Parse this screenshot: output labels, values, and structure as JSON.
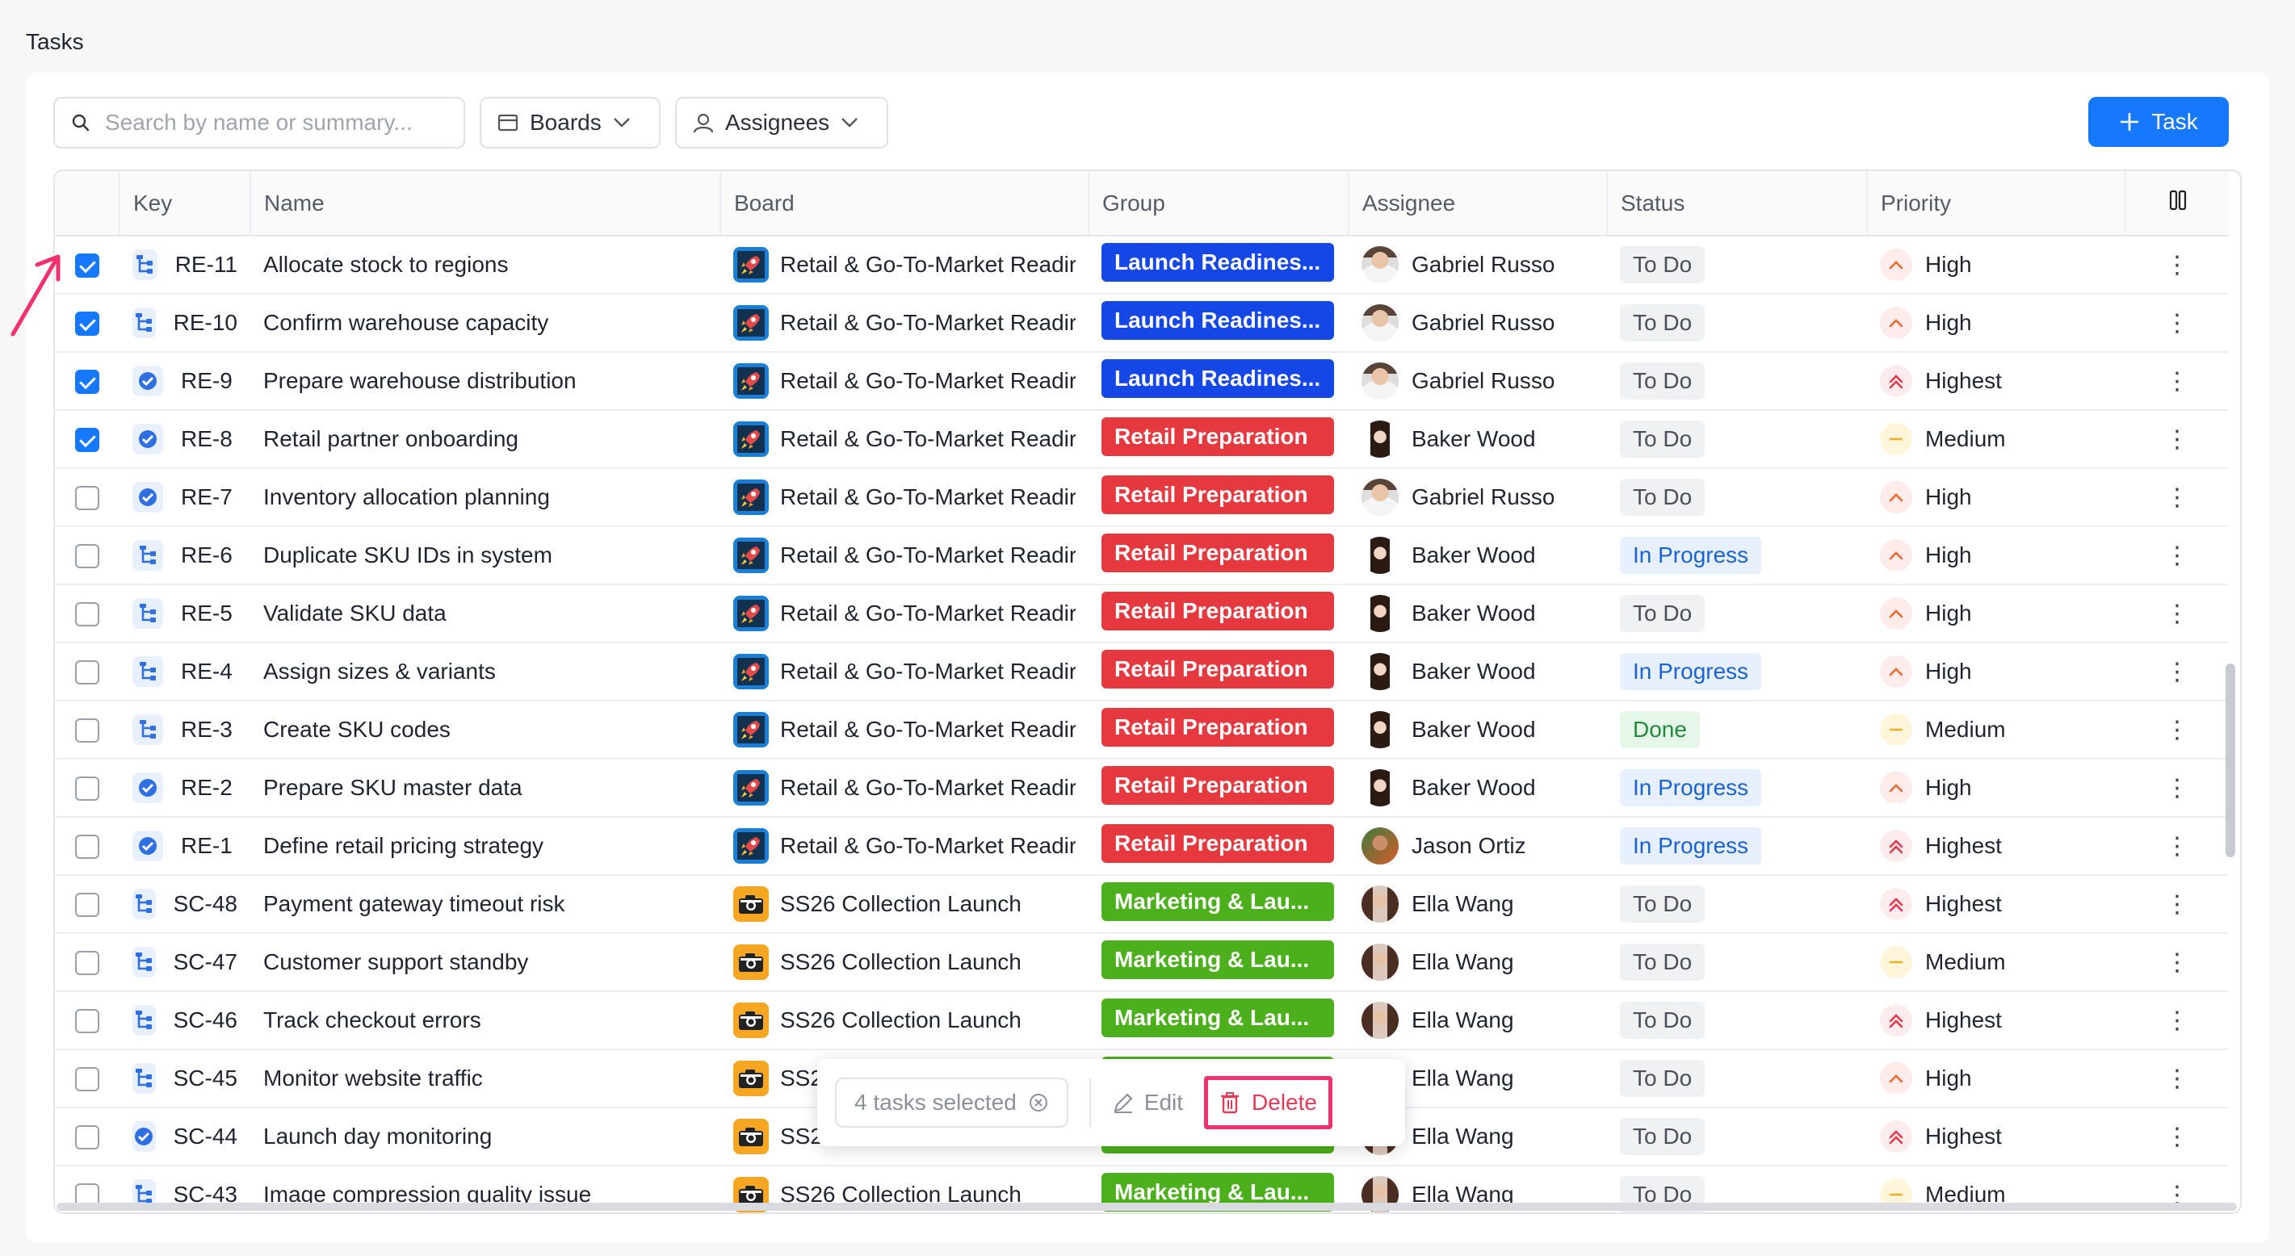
{
  "page": {
    "title": "Tasks"
  },
  "toolbar": {
    "search_placeholder": "Search by name or summary...",
    "boards_label": "Boards",
    "assignees_label": "Assignees",
    "add_task_label": "Task"
  },
  "table": {
    "columns": [
      "Key",
      "Name",
      "Board",
      "Group",
      "Assignee",
      "Status",
      "Priority"
    ],
    "rows": [
      {
        "checked": true,
        "type": "subtask",
        "key": "RE-11",
        "name": "Allocate stock to regions",
        "board": "Retail & Go-To-Market Readir",
        "board_icon": "rocket",
        "group": "Launch Readines...",
        "group_color": "#1447e6",
        "assignee": "Gabriel Russo",
        "avatar": "male",
        "status": "To Do",
        "priority": "High"
      },
      {
        "checked": true,
        "type": "subtask",
        "key": "RE-10",
        "name": "Confirm warehouse capacity",
        "board": "Retail & Go-To-Market Readir",
        "board_icon": "rocket",
        "group": "Launch Readines...",
        "group_color": "#1447e6",
        "assignee": "Gabriel Russo",
        "avatar": "male",
        "status": "To Do",
        "priority": "High"
      },
      {
        "checked": true,
        "type": "task",
        "key": "RE-9",
        "name": "Prepare warehouse distribution",
        "board": "Retail & Go-To-Market Readir",
        "board_icon": "rocket",
        "group": "Launch Readines...",
        "group_color": "#1447e6",
        "assignee": "Gabriel Russo",
        "avatar": "male",
        "status": "To Do",
        "priority": "Highest"
      },
      {
        "checked": true,
        "type": "task",
        "key": "RE-8",
        "name": "Retail partner onboarding",
        "board": "Retail & Go-To-Market Readir",
        "board_icon": "rocket",
        "group": "Retail Preparation",
        "group_color": "#e5393f",
        "assignee": "Baker Wood",
        "avatar": "female",
        "status": "To Do",
        "priority": "Medium"
      },
      {
        "checked": false,
        "type": "task",
        "key": "RE-7",
        "name": "Inventory allocation planning",
        "board": "Retail & Go-To-Market Readir",
        "board_icon": "rocket",
        "group": "Retail Preparation",
        "group_color": "#e5393f",
        "assignee": "Gabriel Russo",
        "avatar": "male",
        "status": "To Do",
        "priority": "High"
      },
      {
        "checked": false,
        "type": "subtask",
        "key": "RE-6",
        "name": "Duplicate SKU IDs in system",
        "board": "Retail & Go-To-Market Readir",
        "board_icon": "rocket",
        "group": "Retail Preparation",
        "group_color": "#e5393f",
        "assignee": "Baker Wood",
        "avatar": "female",
        "status": "In Progress",
        "priority": "High"
      },
      {
        "checked": false,
        "type": "subtask",
        "key": "RE-5",
        "name": "Validate SKU data",
        "board": "Retail & Go-To-Market Readir",
        "board_icon": "rocket",
        "group": "Retail Preparation",
        "group_color": "#e5393f",
        "assignee": "Baker Wood",
        "avatar": "female",
        "status": "To Do",
        "priority": "High"
      },
      {
        "checked": false,
        "type": "subtask",
        "key": "RE-4",
        "name": "Assign sizes & variants",
        "board": "Retail & Go-To-Market Readir",
        "board_icon": "rocket",
        "group": "Retail Preparation",
        "group_color": "#e5393f",
        "assignee": "Baker Wood",
        "avatar": "female",
        "status": "In Progress",
        "priority": "High"
      },
      {
        "checked": false,
        "type": "subtask",
        "key": "RE-3",
        "name": "Create SKU codes",
        "board": "Retail & Go-To-Market Readir",
        "board_icon": "rocket",
        "group": "Retail Preparation",
        "group_color": "#e5393f",
        "assignee": "Baker Wood",
        "avatar": "female",
        "status": "Done",
        "priority": "Medium"
      },
      {
        "checked": false,
        "type": "task",
        "key": "RE-2",
        "name": "Prepare SKU master data",
        "board": "Retail & Go-To-Market Readir",
        "board_icon": "rocket",
        "group": "Retail Preparation",
        "group_color": "#e5393f",
        "assignee": "Baker Wood",
        "avatar": "female",
        "status": "In Progress",
        "priority": "High"
      },
      {
        "checked": false,
        "type": "task",
        "key": "RE-1",
        "name": "Define retail pricing strategy",
        "board": "Retail & Go-To-Market Readir",
        "board_icon": "rocket",
        "group": "Retail Preparation",
        "group_color": "#e5393f",
        "assignee": "Jason Ortiz",
        "avatar": "jason",
        "status": "In Progress",
        "priority": "Highest"
      },
      {
        "checked": false,
        "type": "subtask",
        "key": "SC-48",
        "name": "Payment gateway timeout risk",
        "board": "SS26 Collection Launch",
        "board_icon": "camera",
        "group": "Marketing & Lau...",
        "group_color": "#4caf1c",
        "assignee": "Ella Wang",
        "avatar": "ella",
        "status": "To Do",
        "priority": "Highest"
      },
      {
        "checked": false,
        "type": "subtask",
        "key": "SC-47",
        "name": "Customer support standby",
        "board": "SS26 Collection Launch",
        "board_icon": "camera",
        "group": "Marketing & Lau...",
        "group_color": "#4caf1c",
        "assignee": "Ella Wang",
        "avatar": "ella",
        "status": "To Do",
        "priority": "Medium"
      },
      {
        "checked": false,
        "type": "subtask",
        "key": "SC-46",
        "name": "Track checkout errors",
        "board": "SS26 Collection Launch",
        "board_icon": "camera",
        "group": "Marketing & Lau...",
        "group_color": "#4caf1c",
        "assignee": "Ella Wang",
        "avatar": "ella",
        "status": "To Do",
        "priority": "Highest"
      },
      {
        "checked": false,
        "type": "subtask",
        "key": "SC-45",
        "name": "Monitor website traffic",
        "board": "SS26 Collection Launch",
        "board_icon": "camera",
        "group": "Marketing & Lau...",
        "group_color": "#4caf1c",
        "assignee": "Ella Wang",
        "avatar": "ella",
        "status": "To Do",
        "priority": "High"
      },
      {
        "checked": false,
        "type": "task",
        "key": "SC-44",
        "name": "Launch day monitoring",
        "board": "SS26 Collection Launch",
        "board_icon": "camera",
        "group": "Marketing & Lau...",
        "group_color": "#4caf1c",
        "assignee": "Ella Wang",
        "avatar": "ella",
        "status": "To Do",
        "priority": "Highest"
      },
      {
        "checked": false,
        "type": "subtask",
        "key": "SC-43",
        "name": "Image compression quality issue",
        "board": "SS26 Collection Launch",
        "board_icon": "camera",
        "group": "Marketing & Lau...",
        "group_color": "#4caf1c",
        "assignee": "Ella Wang",
        "avatar": "ella",
        "status": "To Do",
        "priority": "Medium"
      }
    ]
  },
  "status_colors": {
    "To Do": {
      "bg": "#f0f1f3",
      "fg": "#4a4f59"
    },
    "In Progress": {
      "bg": "#e6f0ff",
      "fg": "#1a62d6"
    },
    "Done": {
      "bg": "#e4f7e8",
      "fg": "#25893c"
    }
  },
  "priority_colors": {
    "High": {
      "bg": "#fdecea",
      "fg": "#ef6a2a"
    },
    "Highest": {
      "bg": "#fdecee",
      "fg": "#e5394d"
    },
    "Medium": {
      "bg": "#fff5db",
      "fg": "#f2b01e"
    }
  },
  "bulk_bar": {
    "selected_label": "4 tasks selected",
    "edit_label": "Edit",
    "delete_label": "Delete"
  }
}
